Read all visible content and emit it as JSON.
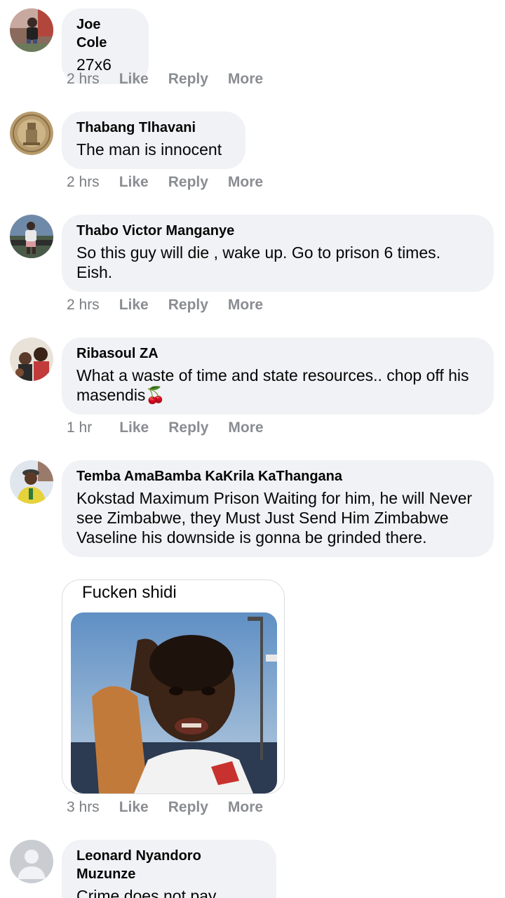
{
  "comments": [
    {
      "author": "Joe Cole",
      "text": "27x6",
      "time": "2 hrs",
      "like": "Like",
      "reply": "Reply",
      "more": "More"
    },
    {
      "author": "Thabang Tlhavani",
      "text": "The man is innocent",
      "time": "2 hrs",
      "like": "Like",
      "reply": "Reply",
      "more": "More"
    },
    {
      "author": "Thabo Victor Manganye",
      "text": "So this guy will die , wake up. Go to prison 6 times. Eish.",
      "time": "2 hrs",
      "like": "Like",
      "reply": "Reply",
      "more": "More"
    },
    {
      "author": "Ribasoul ZA",
      "text": "What a waste of time and state resources.. chop off his masendis🍒",
      "time": "1 hr",
      "like": "Like",
      "reply": "Reply",
      "more": "More"
    },
    {
      "author": "Temba AmaBamba KaKrila KaThangana",
      "text": "Kokstad Maximum Prison Waiting for him, he will Never see Zimbabwe, they Must Just Send Him Zimbabwe Vaseline his downside is gonna be grinded there.",
      "time": "3 hrs",
      "like": "Like",
      "reply": "Reply",
      "more": "More",
      "meme_caption": "Fucken shidi"
    },
    {
      "author": "Leonard Nyandoro Muzunze",
      "text": "Crime does not pay"
    }
  ]
}
